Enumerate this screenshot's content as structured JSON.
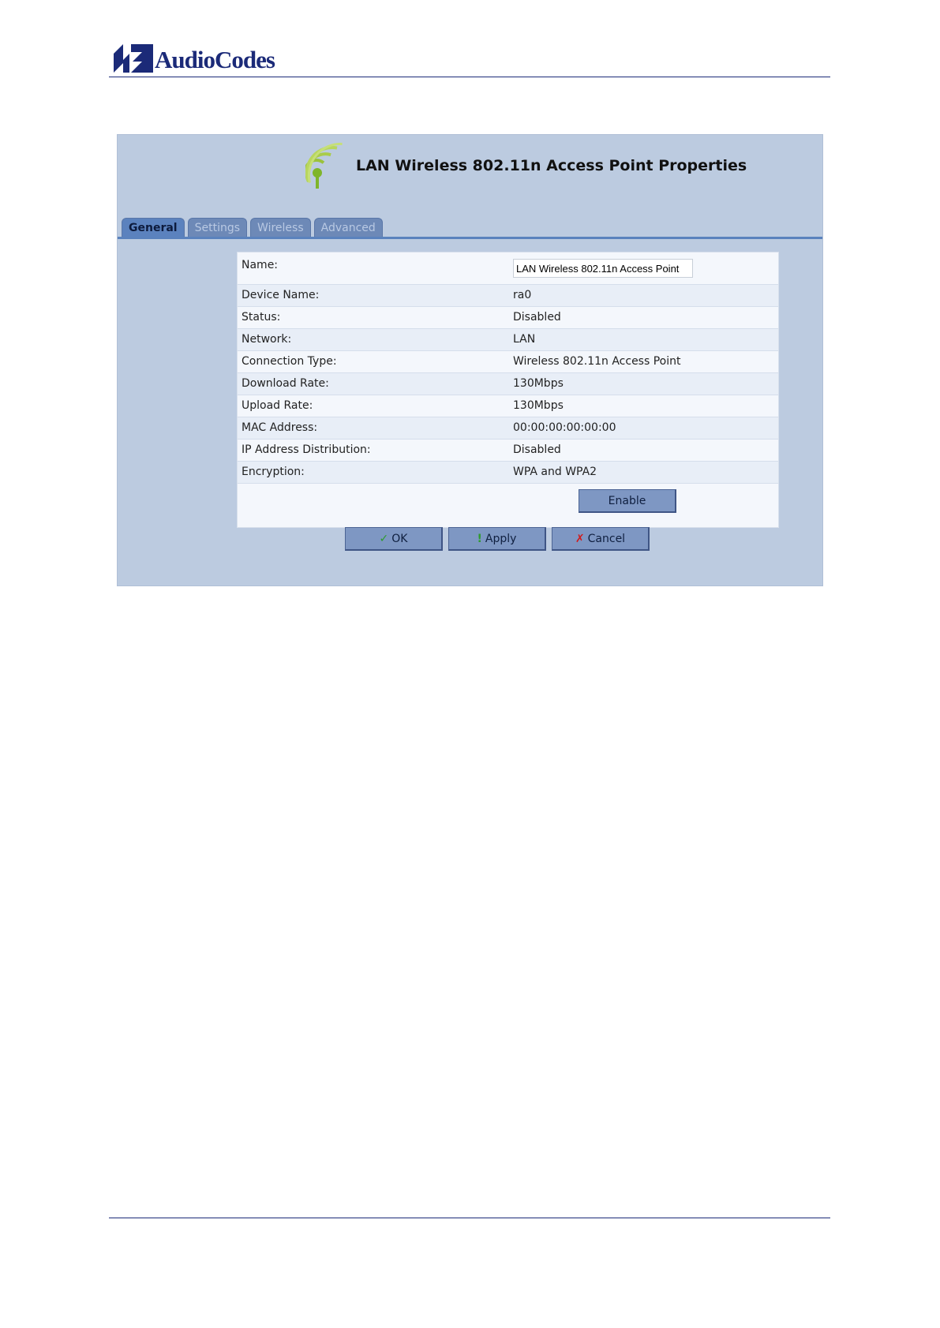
{
  "brand": {
    "name": "AudioCodes",
    "color": "#1b2a78"
  },
  "panel": {
    "title": "LAN Wireless 802.11n Access Point Properties",
    "icon": "wifi-antenna-icon",
    "tabs": [
      {
        "label": "General",
        "active": true
      },
      {
        "label": "Settings",
        "active": false
      },
      {
        "label": "Wireless",
        "active": false
      },
      {
        "label": "Advanced",
        "active": false
      }
    ],
    "name_field": {
      "label": "Name:",
      "value": "LAN Wireless 802.11n Access Point"
    },
    "properties": [
      {
        "label": "Device Name:",
        "value": "ra0"
      },
      {
        "label": "Status:",
        "value": "Disabled"
      },
      {
        "label": "Network:",
        "value": "LAN"
      },
      {
        "label": "Connection Type:",
        "value": "Wireless 802.11n Access Point"
      },
      {
        "label": "Download Rate:",
        "value": "130Mbps"
      },
      {
        "label": "Upload Rate:",
        "value": "130Mbps"
      },
      {
        "label": "MAC Address:",
        "value": "00:00:00:00:00:00"
      },
      {
        "label": "IP Address Distribution:",
        "value": "Disabled"
      },
      {
        "label": "Encryption:",
        "value": "WPA and WPA2"
      }
    ],
    "enable_button": "Enable",
    "actions": {
      "ok": {
        "label": "OK",
        "icon": "check-icon",
        "color": "#2e9b2e"
      },
      "apply": {
        "label": "Apply",
        "icon": "exclamation-icon",
        "color": "#2e9b2e"
      },
      "cancel": {
        "label": "Cancel",
        "icon": "x-icon",
        "color": "#d11a1a"
      }
    }
  }
}
